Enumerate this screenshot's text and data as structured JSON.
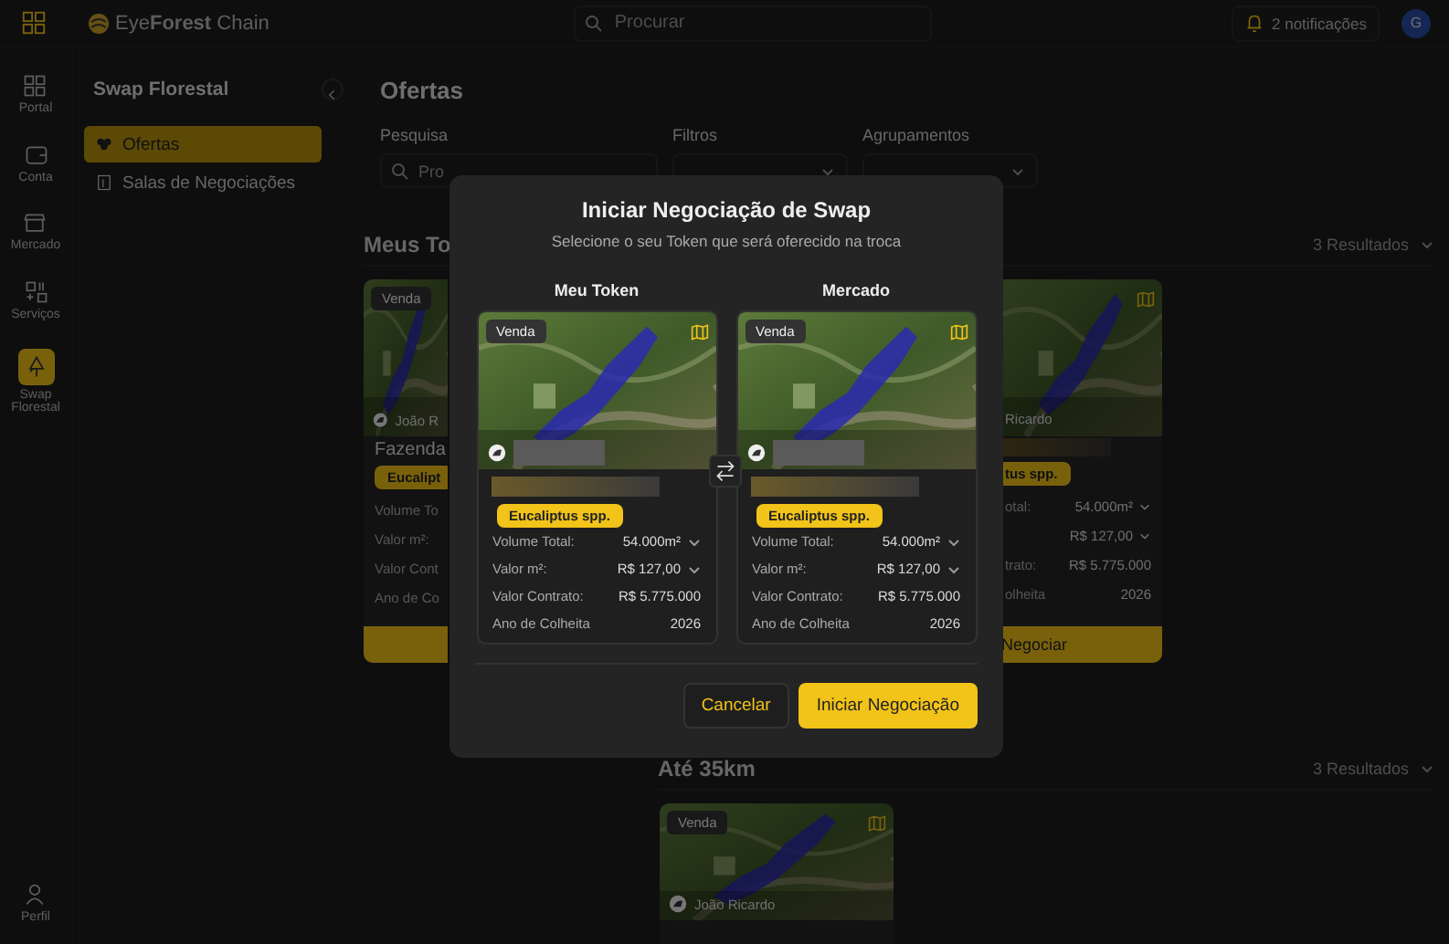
{
  "top_bar": {
    "logo": "Eye**Forest** Chain",
    "search": {
      "placeholder": "Procurar"
    },
    "notifications": "2 notificações",
    "avatar": "G"
  },
  "rail": [
    {
      "label": "Portal",
      "selected": false
    },
    {
      "label": "Conta",
      "selected": false
    },
    {
      "label": "Mercado",
      "selected": false
    },
    {
      "label": "Serviços",
      "selected": false
    },
    {
      "label": "Swap Florestal",
      "selected": true
    }
  ],
  "rail_bottom": {
    "label": "Perfil"
  },
  "sidebar": {
    "title": "Swap Florestal",
    "items": [
      {
        "label": "Ofertas",
        "selected": true
      },
      {
        "label": "Salas de Negociações",
        "selected": false
      }
    ]
  },
  "main": {
    "title": "Ofertas",
    "filters": [
      {
        "label": "Pesquisa",
        "placeholder": "Pro"
      },
      {
        "label": "Filtros"
      },
      {
        "label": "Agrupamentos"
      }
    ],
    "sections": [
      {
        "title": "Meus To",
        "results": "3 Resultados",
        "cards": [
          {
            "kind": "left",
            "badge": "Venda",
            "owner": "João R",
            "title": "Fazenda",
            "tag": "Eucalipt",
            "rows": [
              {
                "label": "Volume To"
              },
              {
                "label": "Valor m²:"
              },
              {
                "label": "Valor Cont"
              },
              {
                "label": "Ano de Co"
              }
            ]
          },
          {
            "kind": "right",
            "owner": "Ricardo",
            "tag": "tus spp.",
            "rows": [
              {
                "label": "otal:",
                "value": "54.000m²",
                "expandable": true
              },
              {
                "value": "R$ 127,00",
                "expandable": true
              },
              {
                "label": "trato:",
                "value": "R$ 5.775.000",
                "expandable": false
              },
              {
                "label": "olheita",
                "value": "2026",
                "expandable": false
              }
            ],
            "button": "Negociar"
          }
        ]
      },
      {
        "title": "Até 35km",
        "results": "3 Resultados",
        "cards": [
          {
            "kind": "full",
            "badge": "Venda",
            "owner": "João Ricardo"
          }
        ]
      }
    ]
  },
  "modal": {
    "title": "Iniciar Negociação de Swap",
    "subtitle": "Selecione o seu Token que será oferecido na troca",
    "columns": [
      {
        "heading": "Meu Token",
        "badge": "Venda",
        "tag": "Eucaliptus spp.",
        "rows": [
          {
            "label": "Volume Total:",
            "value": "54.000m²",
            "expandable": true
          },
          {
            "label": "Valor m²:",
            "value": "R$ 127,00",
            "expandable": true
          },
          {
            "label": "Valor Contrato:",
            "value": "R$ 5.775.000",
            "expandable": false
          },
          {
            "label": "Ano de Colheita",
            "value": "2026",
            "expandable": false
          }
        ]
      },
      {
        "heading": "Mercado",
        "badge": "Venda",
        "tag": "Eucaliptus spp.",
        "rows": [
          {
            "label": "Volume Total:",
            "value": "54.000m²",
            "expandable": true
          },
          {
            "label": "Valor m²:",
            "value": "R$ 127,00",
            "expandable": true
          },
          {
            "label": "Valor Contrato:",
            "value": "R$ 5.775.000",
            "expandable": false
          },
          {
            "label": "Ano de Colheita",
            "value": "2026",
            "expandable": false
          }
        ]
      }
    ],
    "buttons": {
      "cancel": "Cancelar",
      "confirm": "Iniciar Negociação"
    }
  }
}
